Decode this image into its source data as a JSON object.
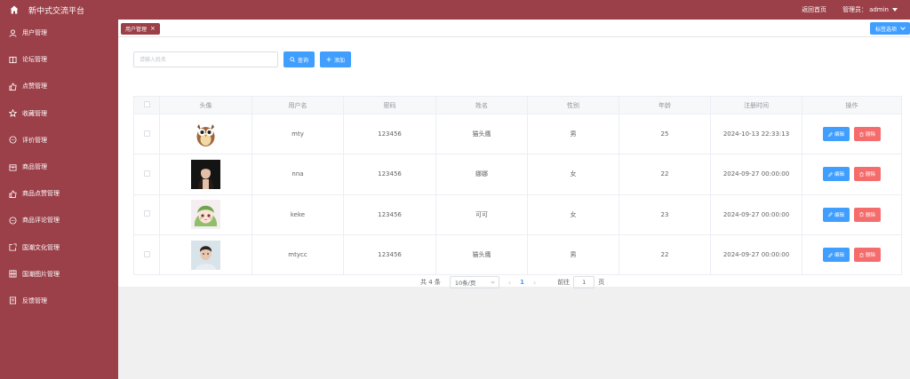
{
  "header": {
    "title": "新中式交流平台",
    "back_home": "返回首页",
    "admin_prefix": "管理员：",
    "admin_name": "admin"
  },
  "sidebar": {
    "items": [
      {
        "label": "用户管理",
        "icon": "user-icon"
      },
      {
        "label": "论坛管理",
        "icon": "book-icon"
      },
      {
        "label": "点赞管理",
        "icon": "thumbs-up-icon"
      },
      {
        "label": "收藏管理",
        "icon": "star-icon"
      },
      {
        "label": "评价管理",
        "icon": "chat-icon"
      },
      {
        "label": "商品管理",
        "icon": "box-icon"
      },
      {
        "label": "商品点赞管理",
        "icon": "thumbs-up-icon"
      },
      {
        "label": "商品评论管理",
        "icon": "chat-icon"
      },
      {
        "label": "国潮文化管理",
        "icon": "external-icon"
      },
      {
        "label": "国潮图片管理",
        "icon": "film-icon"
      },
      {
        "label": "反馈管理",
        "icon": "document-icon"
      }
    ]
  },
  "tabs": {
    "active_label": "用户管理",
    "options_label": "标签选项"
  },
  "toolbar": {
    "search_placeholder": "请输入姓名",
    "query_label": "查询",
    "add_label": "添加"
  },
  "table": {
    "columns": [
      "头像",
      "用户名",
      "密码",
      "姓名",
      "性别",
      "年龄",
      "注册时间",
      "操作"
    ],
    "edit_label": "编辑",
    "delete_label": "删除",
    "rows": [
      {
        "username": "mty",
        "password": "123456",
        "name": "猫头鹰",
        "gender": "男",
        "age": "25",
        "registered": "2024-10-13 22:33:13",
        "avatar": "owl-avatar"
      },
      {
        "username": "nna",
        "password": "123456",
        "name": "娜娜",
        "gender": "女",
        "age": "22",
        "registered": "2024-09-27 00:00:00",
        "avatar": "portrait-dark-avatar"
      },
      {
        "username": "keke",
        "password": "123456",
        "name": "可可",
        "gender": "女",
        "age": "23",
        "registered": "2024-09-27 00:00:00",
        "avatar": "anime-girl-avatar"
      },
      {
        "username": "mtycc",
        "password": "123456",
        "name": "猫头鹰",
        "gender": "男",
        "age": "22",
        "registered": "2024-09-27 00:00:00",
        "avatar": "boy-portrait-avatar"
      }
    ]
  },
  "pagination": {
    "total_text": "共 4 条",
    "page_size": "10条/页",
    "current_page": "1",
    "goto_prefix": "前往",
    "goto_value": "1",
    "goto_suffix": "页"
  },
  "colors": {
    "brand": "#9b3f48",
    "primary": "#409eff",
    "danger": "#f56c6c"
  }
}
